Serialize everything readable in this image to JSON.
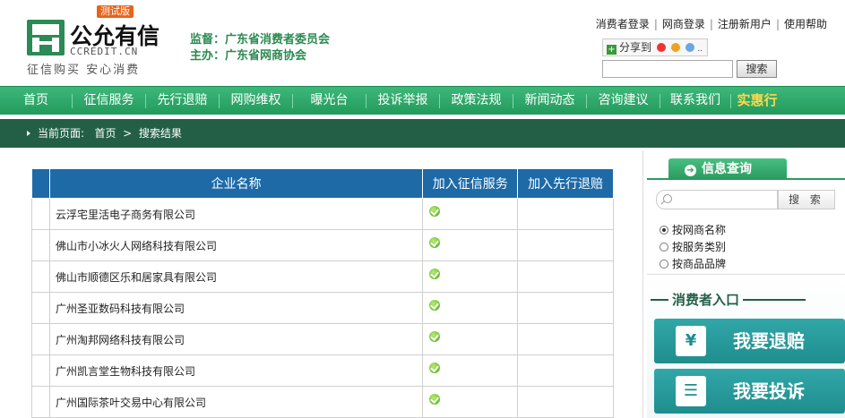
{
  "header": {
    "badge": "测试版",
    "site_name": "公允有信",
    "domain": "CCREDIT.CN",
    "slogan": "征信购买 安心消费",
    "org_supervise": "监督：广东省消费者委员会",
    "org_host": "主办：广东省网商协会",
    "top_links": [
      "消费者登录",
      "网商登录",
      "注册新用户",
      "使用帮助"
    ],
    "share_label": "分享到",
    "search_button": "搜索",
    "search_value": ""
  },
  "nav": {
    "items": [
      "首页",
      "征信服务",
      "先行退赔",
      "网购维权",
      "曝光台",
      "投诉举报",
      "政策法规",
      "新闻动态",
      "咨询建议",
      "联系我们"
    ],
    "hot": "实惠行"
  },
  "breadcrumb": {
    "prefix": "当前页面:",
    "home": "首页",
    "sep": ">",
    "current": "搜索结果"
  },
  "table": {
    "headers": [
      "企业名称",
      "加入征信服务",
      "加入先行退赔"
    ],
    "rows": [
      {
        "name": "云浮宅里活电子商务有限公司",
        "credit": true,
        "refund": false
      },
      {
        "name": "佛山市小冰火人网络科技有限公司",
        "credit": true,
        "refund": false
      },
      {
        "name": "佛山市顺德区乐和居家具有限公司",
        "credit": true,
        "refund": false
      },
      {
        "name": "广州圣亚数码科技有限公司",
        "credit": true,
        "refund": false
      },
      {
        "name": "广州淘邦网络科技有限公司",
        "credit": true,
        "refund": false
      },
      {
        "name": "广州凯言堂生物科技有限公司",
        "credit": true,
        "refund": false
      },
      {
        "name": "广州国际茶叶交易中心有限公司",
        "credit": true,
        "refund": false
      }
    ]
  },
  "side": {
    "tab_title": "信息查询",
    "search_placeholder": "",
    "search_button": "搜 索",
    "radios": [
      {
        "label": "按网商名称",
        "checked": true
      },
      {
        "label": "按服务类别",
        "checked": false
      },
      {
        "label": "按商品品牌",
        "checked": false
      }
    ],
    "entry_title": "消费者入口",
    "buttons": [
      {
        "label": "我要退赔",
        "icon": "yen-icon"
      },
      {
        "label": "我要投诉",
        "icon": "document-icon"
      }
    ]
  },
  "colors": {
    "nav_green": "#229a5c",
    "breadcrumb": "#235f47",
    "table_header": "#1e6aa7",
    "teal_button": "#1f8d8e",
    "hot": "#ffd84a"
  }
}
